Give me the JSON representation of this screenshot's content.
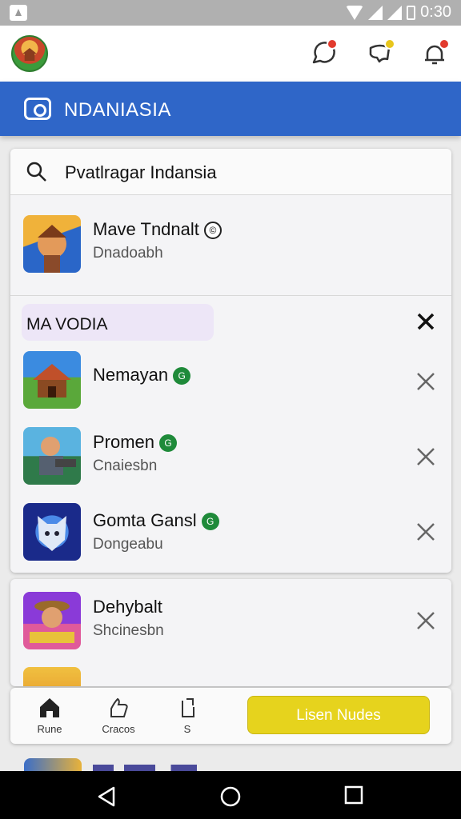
{
  "status_bar": {
    "time": "0:30"
  },
  "banner": {
    "title": "NDANIASIA"
  },
  "search": {
    "value": "Pvatlragar Indansia"
  },
  "featured": {
    "title": "Mave Tndnalt",
    "subtitle": "Dnadoabh",
    "badge": "©"
  },
  "section": {
    "title": "MA VODIA"
  },
  "items": [
    {
      "title": "Nemayan",
      "badge": "G",
      "subtitle": ""
    },
    {
      "title": "Promen",
      "badge": "G",
      "subtitle": "Cnaiesbn"
    },
    {
      "title": "Gomta Gansl",
      "badge": "G",
      "subtitle": "Dongeabu"
    }
  ],
  "card2_item": {
    "title": "Dehybalt",
    "subtitle": "Shcinesbn"
  },
  "bottom_nav": [
    {
      "label": "Rune"
    },
    {
      "label": "Cracos"
    },
    {
      "label": "S"
    }
  ],
  "cta": {
    "label": "Lisen Nudes"
  },
  "colors": {
    "banner": "#2f66c8",
    "cta": "#e6d31d",
    "badge": "#1f8a3a"
  }
}
